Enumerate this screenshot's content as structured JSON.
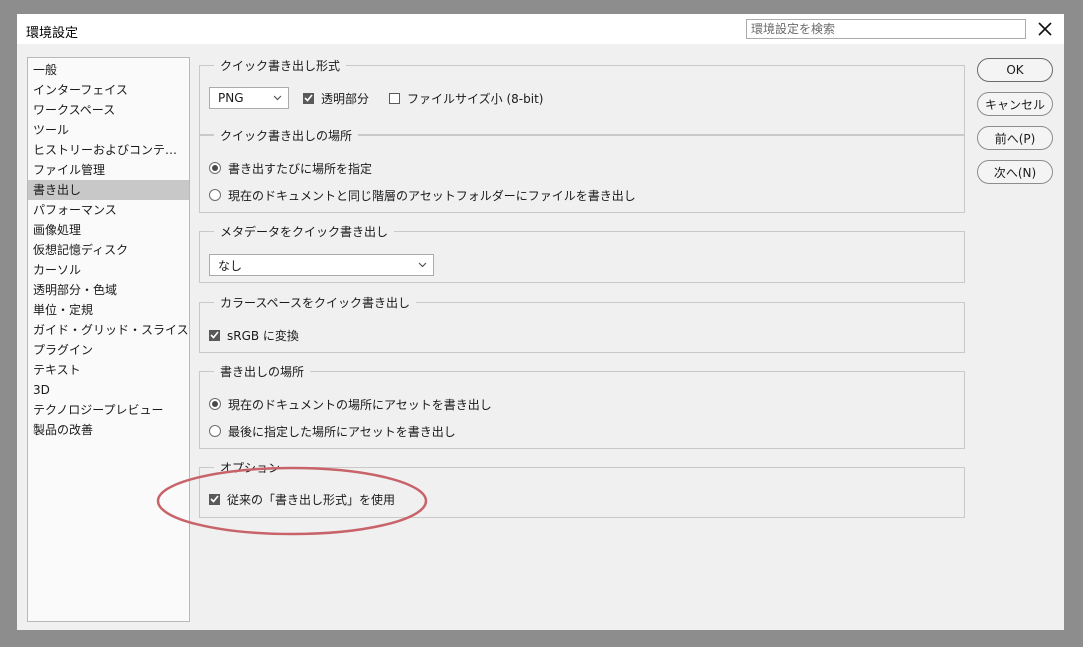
{
  "window": {
    "title": "環境設定",
    "search_placeholder": "環境設定を検索"
  },
  "sidebar": {
    "items": [
      {
        "label": "一般"
      },
      {
        "label": "インターフェイス"
      },
      {
        "label": "ワークスペース"
      },
      {
        "label": "ツール"
      },
      {
        "label": "ヒストリーおよびコンテンツ認証 ..."
      },
      {
        "label": "ファイル管理"
      },
      {
        "label": "書き出し",
        "selected": true
      },
      {
        "label": "パフォーマンス"
      },
      {
        "label": "画像処理"
      },
      {
        "label": "仮想記憶ディスク"
      },
      {
        "label": "カーソル"
      },
      {
        "label": "透明部分・色域"
      },
      {
        "label": "単位・定規"
      },
      {
        "label": "ガイド・グリッド・スライス"
      },
      {
        "label": "プラグイン"
      },
      {
        "label": "テキスト"
      },
      {
        "label": "3D"
      },
      {
        "label": "テクノロジープレビュー"
      },
      {
        "label": "製品の改善"
      }
    ]
  },
  "sections": {
    "quick_format": {
      "title": "クイック書き出し形式",
      "format_value": "PNG",
      "transparency_label": "透明部分",
      "transparency_checked": true,
      "small_size_label": "ファイルサイズ小 (8-bit)",
      "small_size_checked": false
    },
    "quick_location": {
      "title": "クイック書き出しの場所",
      "option_ask": "書き出すたびに場所を指定",
      "option_assets": "現在のドキュメントと同じ階層のアセットフォルダーにファイルを書き出し",
      "selected": "option_ask"
    },
    "metadata": {
      "title": "メタデータをクイック書き出し",
      "value": "なし"
    },
    "colorspace": {
      "title": "カラースペースをクイック書き出し",
      "srgb_label": "sRGB に変換",
      "srgb_checked": true
    },
    "export_location": {
      "title": "書き出しの場所",
      "option_current": "現在のドキュメントの場所にアセットを書き出し",
      "option_last": "最後に指定した場所にアセットを書き出し",
      "selected": "option_current"
    },
    "options": {
      "title": "オプション",
      "legacy_label": "従来の「書き出し形式」を使用",
      "legacy_checked": true
    }
  },
  "buttons": {
    "ok": "OK",
    "cancel": "キャンセル",
    "prev": "前へ(P)",
    "next": "次へ(N)"
  },
  "colors": {
    "annotation_circle": "#c8636a"
  },
  "icons": {
    "close": "close-icon",
    "check": "checkmark-icon",
    "dropdown": "chevron-down-icon"
  }
}
